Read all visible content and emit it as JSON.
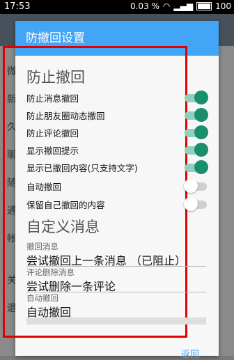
{
  "status_bar": {
    "time": "17:53",
    "network_speed": "0.03 %",
    "battery": "100"
  },
  "background": {
    "rows": [
      "微",
      "新",
      "久",
      "聊",
      "随",
      "通",
      "帐",
      "关",
      "退"
    ]
  },
  "dialog": {
    "title": "防撤回设置",
    "section_prevent": "防止撤回",
    "switches": [
      {
        "label": "防止消息撤回",
        "on": true
      },
      {
        "label": "防止朋友圈动态撤回",
        "on": true
      },
      {
        "label": "防止评论撤回",
        "on": true
      },
      {
        "label": "显示撤回提示",
        "on": true
      },
      {
        "label": "显示已撤回内容(只支持文字)",
        "on": true
      },
      {
        "label": "自动撤回",
        "on": false
      },
      {
        "label": "保留自己撤回的内容",
        "on": false
      }
    ],
    "section_custom": "自定义消息",
    "fields": [
      {
        "label": "撤回消息",
        "value": "尝试撤回上一条消息 （已阻止）"
      },
      {
        "label": "评论删除消息",
        "value": "尝试删除一条评论"
      },
      {
        "label": "自动撤回",
        "value": "自动撤回"
      }
    ],
    "back_button": "返回"
  }
}
